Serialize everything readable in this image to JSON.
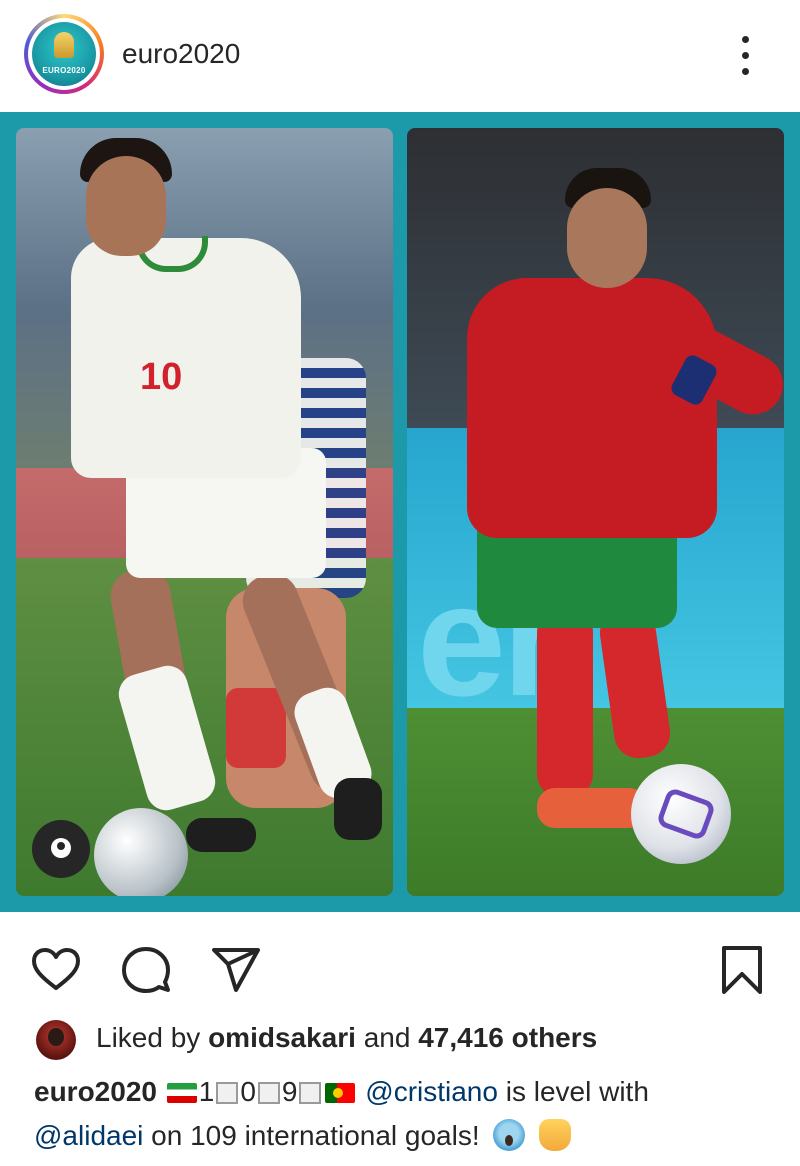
{
  "header": {
    "username": "euro2020",
    "avatar_logo_text": "EURO2020",
    "more_icon": "more-vertical-icon"
  },
  "post_image": {
    "left_board_text": "",
    "right_board_text": "en",
    "left_jersey_number": "10",
    "tag_icon": "user-tag-icon"
  },
  "actions": {
    "like_icon": "heart-icon",
    "comment_icon": "comment-icon",
    "share_icon": "send-icon",
    "save_icon": "bookmark-icon"
  },
  "likes": {
    "prefix": "Liked by",
    "user": "omidsakari",
    "middle": "and",
    "count": "47,416 others"
  },
  "caption": {
    "user": "euro2020",
    "score_parts": [
      "1",
      "0",
      "9"
    ],
    "mention1": "@cristiano",
    "text1": "is level with",
    "mention2": "@alidaei",
    "text2": "on 109 international goals!"
  },
  "colors": {
    "image_background": "#1d9aa9",
    "mention_color": "#00376b",
    "text_color": "#262626"
  }
}
